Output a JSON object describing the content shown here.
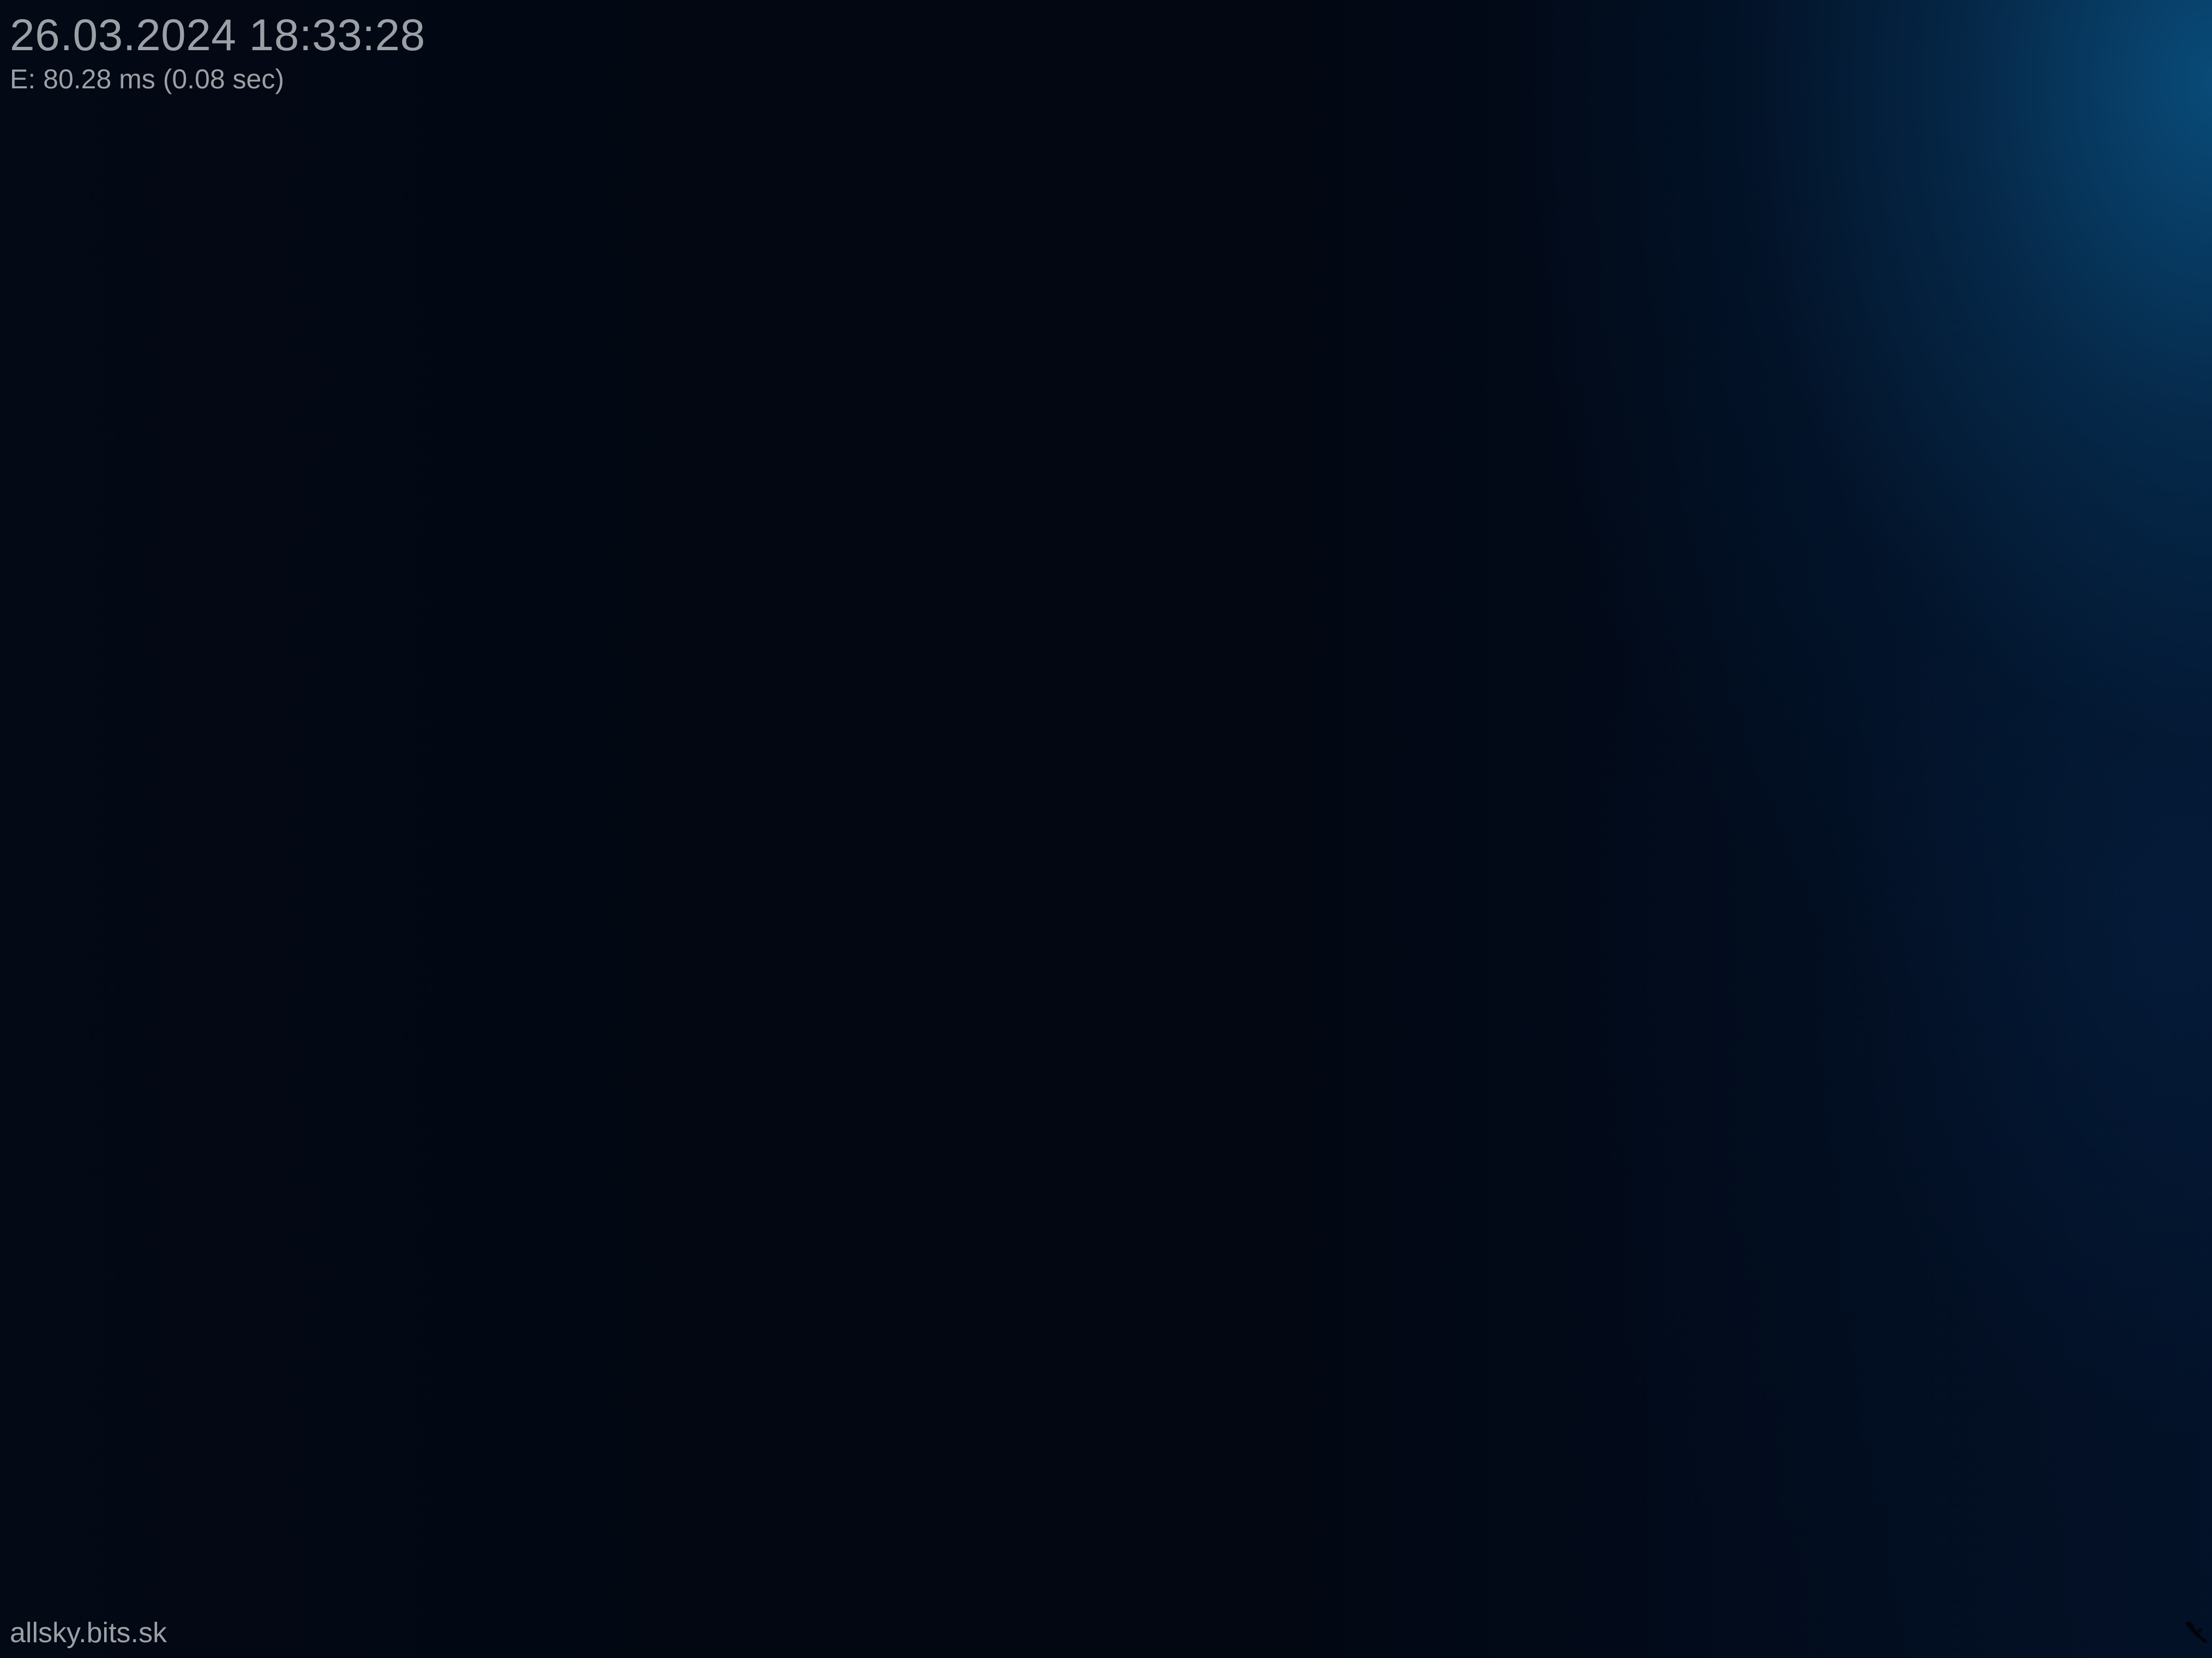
{
  "overlay": {
    "timestamp": "26.03.2024 18:33:28",
    "exposure": "E: 80.28 ms (0.08 sec)"
  },
  "watermark": {
    "label": "allsky.bits.sk"
  },
  "colors": {
    "sky_dark": "#020712",
    "sky_blue": "#0a5587",
    "text": "#9aa0a6"
  }
}
